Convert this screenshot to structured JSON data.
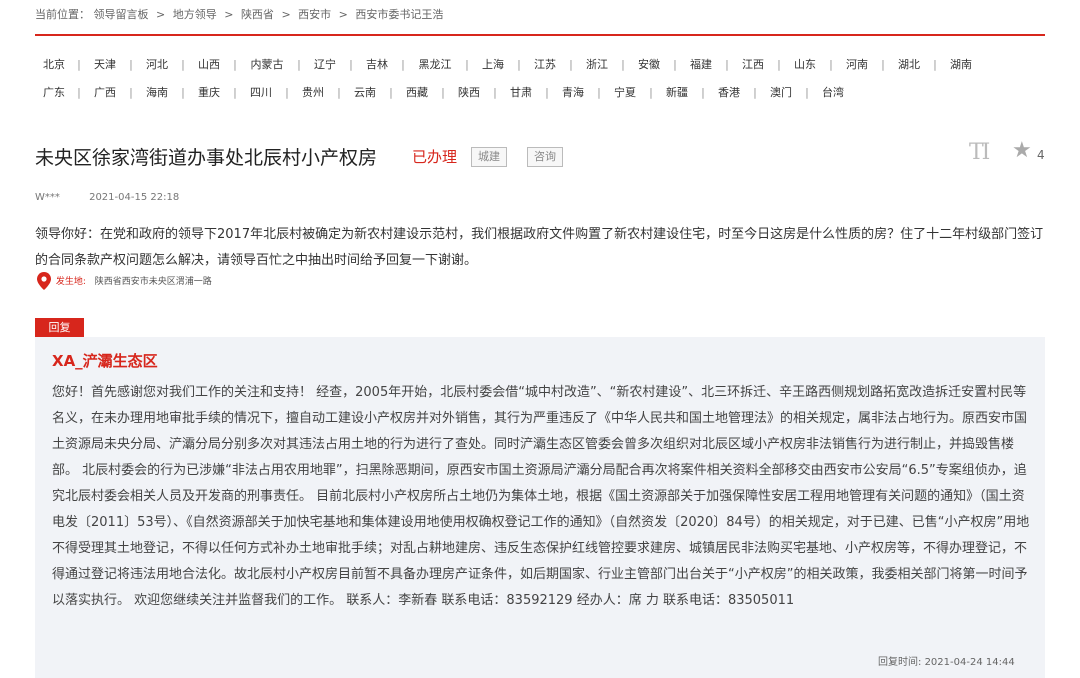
{
  "breadcrumb": {
    "label": "当前位置：",
    "items": [
      "领导留言板",
      "地方领导",
      "陕西省",
      "西安市",
      "西安市委书记王浩"
    ],
    "separator": ">"
  },
  "regions": {
    "row1": [
      "北京",
      "天津",
      "河北",
      "山西",
      "内蒙古",
      "辽宁",
      "吉林",
      "黑龙江",
      "上海",
      "江苏",
      "浙江",
      "安徽",
      "福建",
      "江西",
      "山东",
      "河南",
      "湖北",
      "湖南"
    ],
    "row2": [
      "广东",
      "广西",
      "海南",
      "重庆",
      "四川",
      "贵州",
      "云南",
      "西藏",
      "陕西",
      "甘肃",
      "青海",
      "宁夏",
      "新疆",
      "香港",
      "澳门",
      "台湾"
    ],
    "divider": "|"
  },
  "message": {
    "title": "未央区徐家湾街道办事处北辰村小产权房",
    "status": "已办理",
    "tags": [
      "城建",
      "咨询"
    ],
    "font_icon": "TI",
    "star_count": "4",
    "author": "W***",
    "date": "2021-04-15 22:18",
    "content": "领导你好：在党和政府的领导下2017年北辰村被确定为新农村建设示范村，我们根据政府文件购置了新农村建设住宅，时至今日这房是什么性质的房？住了十二年村级部门签订的合同条款产权问题怎么解决，请领导百忙之中抽出时间给予回复一下谢谢。",
    "location_label": "发生地:",
    "location": "陕西省西安市未央区渭浦一路"
  },
  "reply": {
    "tab_label": "回复",
    "department": "XA_浐灞生态区",
    "content": "您好！首先感谢您对我们工作的关注和支持！ 经查，2005年开始，北辰村委会借“城中村改造”、“新农村建设”、北三环拆迁、辛王路西侧规划路拓宽改造拆迁安置村民等名义，在未办理用地审批手续的情况下，擅自动工建设小产权房并对外销售，其行为严重违反了《中华人民共和国土地管理法》的相关规定，属非法占地行为。原西安市国土资源局未央分局、浐灞分局分别多次对其违法占用土地的行为进行了查处。同时浐灞生态区管委会曾多次组织对北辰区域小产权房非法销售行为进行制止，并捣毁售楼部。 北辰村委会的行为已涉嫌“非法占用农用地罪”，扫黑除恶期间，原西安市国土资源局浐灞分局配合再次将案件相关资料全部移交由西安市公安局“6.5”专案组侦办，追究北辰村委会相关人员及开发商的刑事责任。 目前北辰村小产权房所占土地仍为集体土地，根据《国土资源部关于加强保障性安居工程用地管理有关问题的通知》（国土资电发〔2011〕53号）、《自然资源部关于加快宅基地和集体建设用地使用权确权登记工作的通知》（自然资发〔2020〕84号）的相关规定，对于已建、已售“小产权房”用地不得受理其土地登记，不得以任何方式补办土地审批手续；对乱占耕地建房、违反生态保护红线管控要求建房、城镇居民非法购买宅基地、小产权房等，不得办理登记，不得通过登记将违法用地合法化。故北辰村小产权房目前暂不具备办理房产证条件，如后期国家、行业主管部门出台关于“小产权房”的相关政策，我委相关部门将第一时间予以落实执行。 欢迎您继续关注并监督我们的工作。 联系人：李新春 联系电话：83592129 经办人：席 力 联系电话：83505011",
    "time_label": "回复时间:",
    "time": "2021-04-24 14:44"
  },
  "colors": {
    "accent": "#d7261c",
    "reply_bg": "#f1f3f7"
  }
}
